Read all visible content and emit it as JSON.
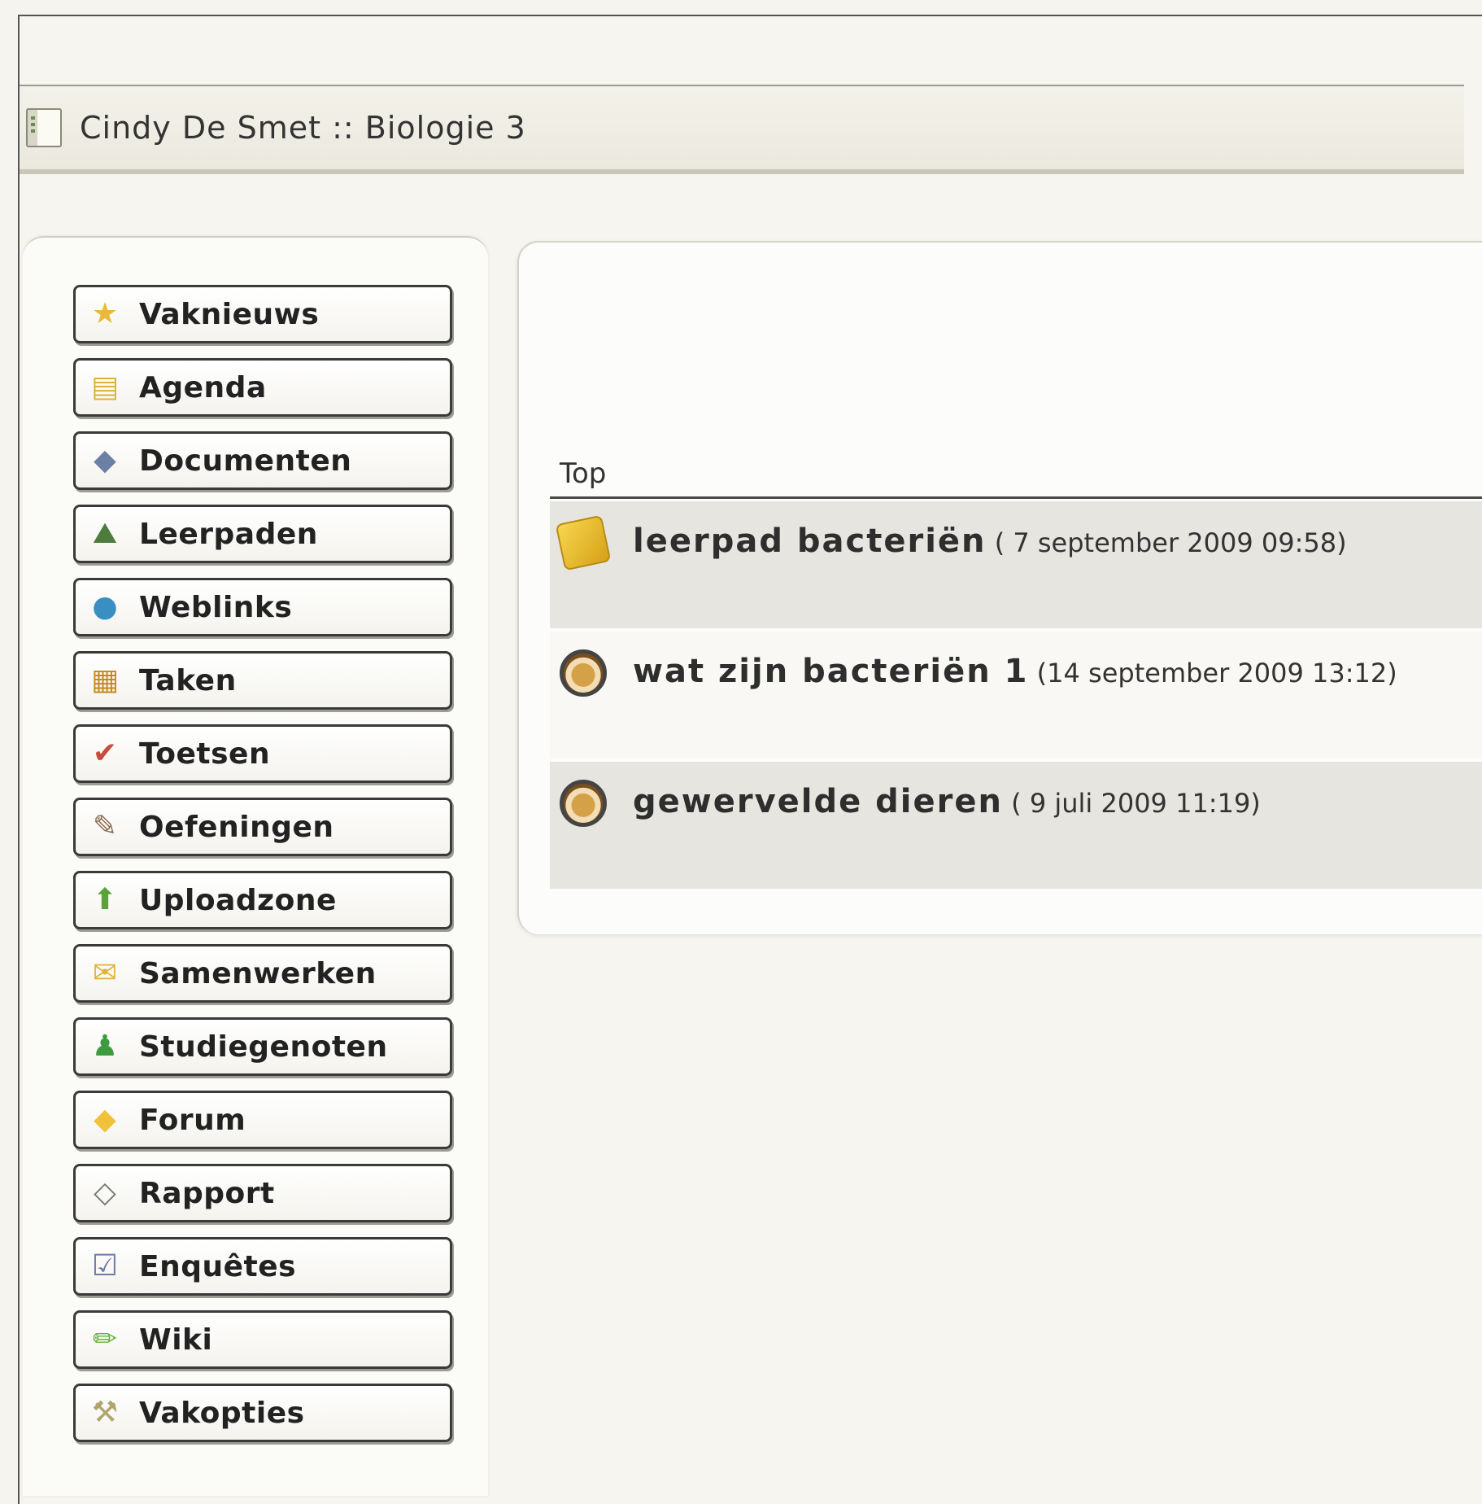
{
  "window": {
    "title": "Cindy De Smet :: Biologie 3"
  },
  "sidebar": {
    "items": [
      {
        "label": "Vaknieuws",
        "icon": "star-icon",
        "glyph": "★",
        "color": "#e8b93a"
      },
      {
        "label": "Agenda",
        "icon": "notepad-icon",
        "glyph": "▤",
        "color": "#d9b33d"
      },
      {
        "label": "Documenten",
        "icon": "folder-icon",
        "glyph": "◆",
        "color": "#6c7fa5"
      },
      {
        "label": "Leerpaden",
        "icon": "learning-path-icon",
        "glyph": "⛰",
        "color": "#4d7d3d"
      },
      {
        "label": "Weblinks",
        "icon": "globe-icon",
        "glyph": "●",
        "color": "#3a8fc2"
      },
      {
        "label": "Taken",
        "icon": "tasks-icon",
        "glyph": "▦",
        "color": "#c88a1b"
      },
      {
        "label": "Toetsen",
        "icon": "quiz-icon",
        "glyph": "✔",
        "color": "#c94b3a"
      },
      {
        "label": "Oefeningen",
        "icon": "exercises-icon",
        "glyph": "✎",
        "color": "#8a6a4a"
      },
      {
        "label": "Uploadzone",
        "icon": "upload-icon",
        "glyph": "⬆",
        "color": "#5aa33a"
      },
      {
        "label": "Samenwerken",
        "icon": "collaborate-icon",
        "glyph": "✉",
        "color": "#e0b33a"
      },
      {
        "label": "Studiegenoten",
        "icon": "person-icon",
        "glyph": "♟",
        "color": "#3e9a3e"
      },
      {
        "label": "Forum",
        "icon": "forum-icon",
        "glyph": "◆",
        "color": "#f0c23a"
      },
      {
        "label": "Rapport",
        "icon": "report-icon",
        "glyph": "◇",
        "color": "#777"
      },
      {
        "label": "Enquêtes",
        "icon": "survey-icon",
        "glyph": "☑",
        "color": "#6d7aa2"
      },
      {
        "label": "Wiki",
        "icon": "pencil-icon",
        "glyph": "✏",
        "color": "#6ab33e"
      },
      {
        "label": "Vakopties",
        "icon": "tools-icon",
        "glyph": "⚒",
        "color": "#b0a56b"
      }
    ]
  },
  "main": {
    "section_title": "Top",
    "items": [
      {
        "name": "leerpad bacteriën",
        "date": " ( 7 september 2009 09:58)",
        "icon": "learning-path-cube-icon"
      },
      {
        "name": "wat zijn bacteriën 1",
        "date": " (14 september 2009 13:12)",
        "icon": "cake-icon"
      },
      {
        "name": "gewervelde dieren",
        "date": " ( 9 juli 2009 11:19)",
        "icon": "cake-icon"
      }
    ]
  }
}
